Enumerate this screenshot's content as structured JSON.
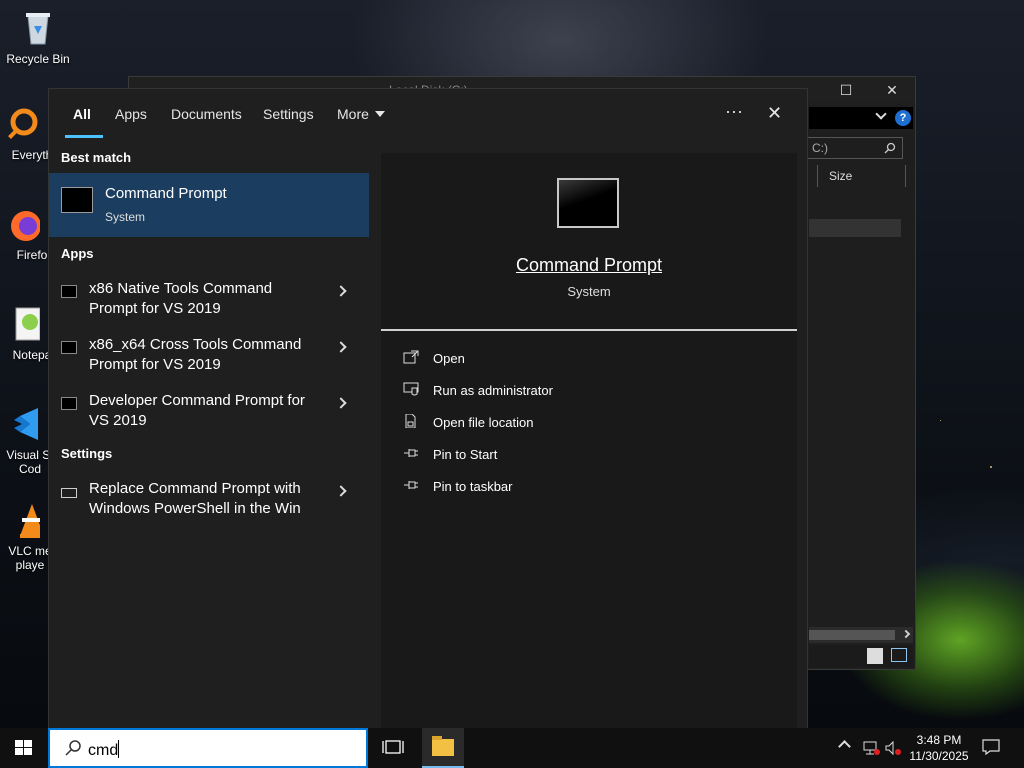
{
  "desktop": {
    "icons": [
      {
        "label": "Recycle Bin",
        "icon": "recycle-bin-icon"
      },
      {
        "label": "Everyth",
        "icon": "everything-search-icon"
      },
      {
        "label": "Firefo",
        "icon": "firefox-icon"
      },
      {
        "label": "Notepa",
        "icon": "notepad-plus-icon"
      },
      {
        "label": "Visual St\nCod",
        "icon": "vscode-icon"
      },
      {
        "label": "VLC me\nplaye",
        "icon": "vlc-icon"
      }
    ]
  },
  "explorer": {
    "title": "Local Disk (C:)",
    "search_placeholder": "C:)",
    "column_size": "Size"
  },
  "search_panel": {
    "tabs": [
      {
        "label": "All",
        "active": true
      },
      {
        "label": "Apps"
      },
      {
        "label": "Documents"
      },
      {
        "label": "Settings"
      },
      {
        "label": "More"
      }
    ],
    "more_options": "···",
    "close": "✕",
    "best_match": {
      "heading": "Best match",
      "title": "Command Prompt",
      "subtitle": "System"
    },
    "apps": {
      "heading": "Apps",
      "items": [
        {
          "label": "x86 Native Tools Command Prompt for VS 2019"
        },
        {
          "label": "x86_x64 Cross Tools Command Prompt for VS 2019"
        },
        {
          "label": "Developer Command Prompt for VS 2019"
        }
      ]
    },
    "settings": {
      "heading": "Settings",
      "items": [
        {
          "label": "Replace Command Prompt with Windows PowerShell in the Win"
        }
      ]
    },
    "preview": {
      "title": "Command Prompt",
      "subtitle": "System",
      "actions": [
        {
          "label": "Open",
          "icon": "open-icon"
        },
        {
          "label": "Run as administrator",
          "icon": "shield-admin-icon"
        },
        {
          "label": "Open file location",
          "icon": "file-location-icon"
        },
        {
          "label": "Pin to Start",
          "icon": "pin-icon"
        },
        {
          "label": "Pin to taskbar",
          "icon": "pin-icon"
        }
      ]
    }
  },
  "taskbar": {
    "search_query": "cmd",
    "clock_time": "3:48 PM",
    "clock_date": "11/30/2025"
  },
  "colors": {
    "accent": "#4cc2ff",
    "selection": "#1b3e60",
    "search_border": "#0078d7"
  }
}
